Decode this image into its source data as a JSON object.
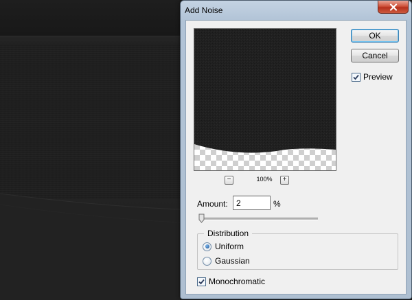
{
  "dialog": {
    "title": "Add Noise",
    "ok_label": "OK",
    "cancel_label": "Cancel",
    "preview_label": "Preview",
    "preview_checked": true,
    "zoom_out_label": "−",
    "zoom_in_label": "+",
    "zoom_level": "100%",
    "amount_label": "Amount:",
    "amount_value": "2",
    "amount_unit": "%",
    "amount_slider_fraction": 0.0,
    "distribution": {
      "title": "Distribution",
      "options": [
        {
          "label": "Uniform",
          "selected": true
        },
        {
          "label": "Gaussian",
          "selected": false
        }
      ]
    },
    "monochromatic_label": "Monochromatic",
    "monochromatic_checked": true
  },
  "icons": {
    "close": "close-icon",
    "check": "check-icon"
  },
  "colors": {
    "canvas_dark": "#1f1f1f",
    "title_bar": "#b9c9dc",
    "close_button": "#c8452f",
    "dialog_face": "#f0f0f0"
  }
}
